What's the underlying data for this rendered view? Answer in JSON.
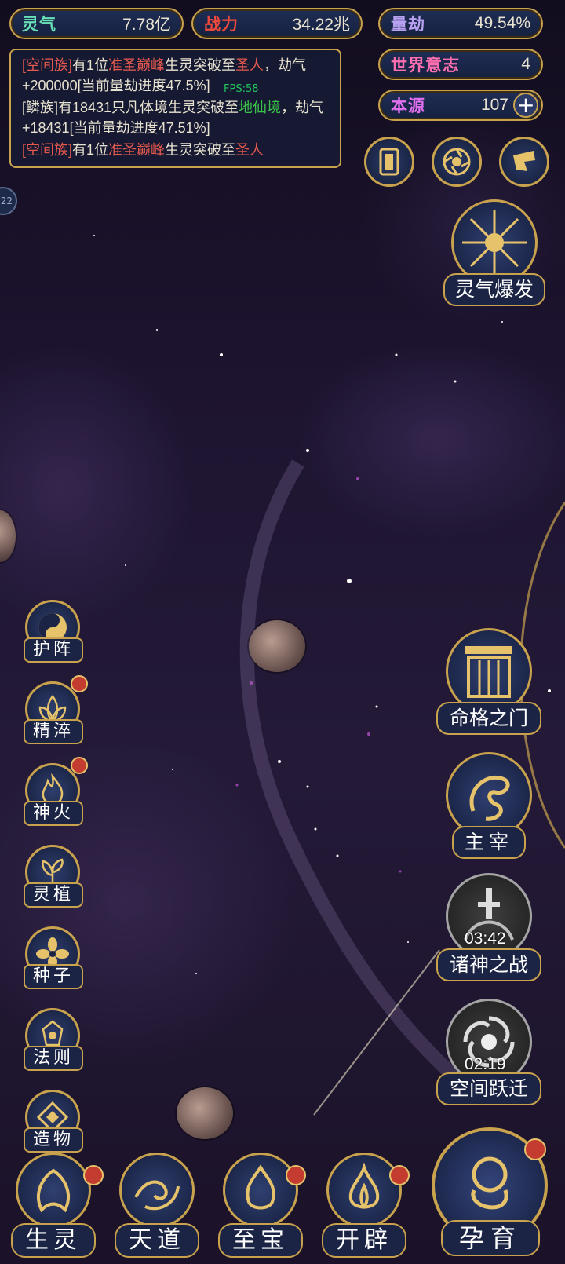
{
  "stats": {
    "lingqi": {
      "label": "灵气",
      "value": "7.78亿"
    },
    "zhanli": {
      "label": "战力",
      "value": "34.22兆"
    },
    "liangjie": {
      "label": "量劫",
      "value": "49.54%"
    },
    "shijie": {
      "label": "世界意志",
      "value": "4"
    },
    "benyuan": {
      "label": "本源",
      "value": "107"
    }
  },
  "log": {
    "line1": {
      "a": "[空间族]",
      "b": "有1位",
      "c": "准圣巅峰",
      "d": "生灵突破至",
      "e": "圣人",
      "f": "，劫气+200000[当前量劫进度47.5%]"
    },
    "line2": {
      "a": "[鳞族]有18431只凡体境生灵突破至",
      "b": "地仙境",
      "c": "，劫气+18431[当前量劫进度47.51%]"
    },
    "line3": {
      "a": "[空间族]",
      "b": "有1位",
      "c": "准圣巅峰",
      "d": "生灵突破至",
      "e": "圣人"
    }
  },
  "fps": "FPS:58",
  "side_badge": "22",
  "top_buttons": {
    "card": "card-icon",
    "portal": "vortex-icon",
    "bag": "pouch-icon"
  },
  "right": {
    "burst": "灵气爆发",
    "gate": "命格之门",
    "ruler": "主宰",
    "war": {
      "label": "诸神之战",
      "timer": "03:42"
    },
    "leap": {
      "label": "空间跃迁",
      "timer": "02:19"
    }
  },
  "left": [
    "护阵",
    "精淬",
    "神火",
    "灵植",
    "种子",
    "法则",
    "造物"
  ],
  "bottom": [
    "生灵",
    "天道",
    "至宝",
    "开辟"
  ],
  "incubate": "孕育",
  "colors": {
    "gold": "#c9a24e",
    "red": "#e85a4f",
    "green": "#3cc44a"
  }
}
